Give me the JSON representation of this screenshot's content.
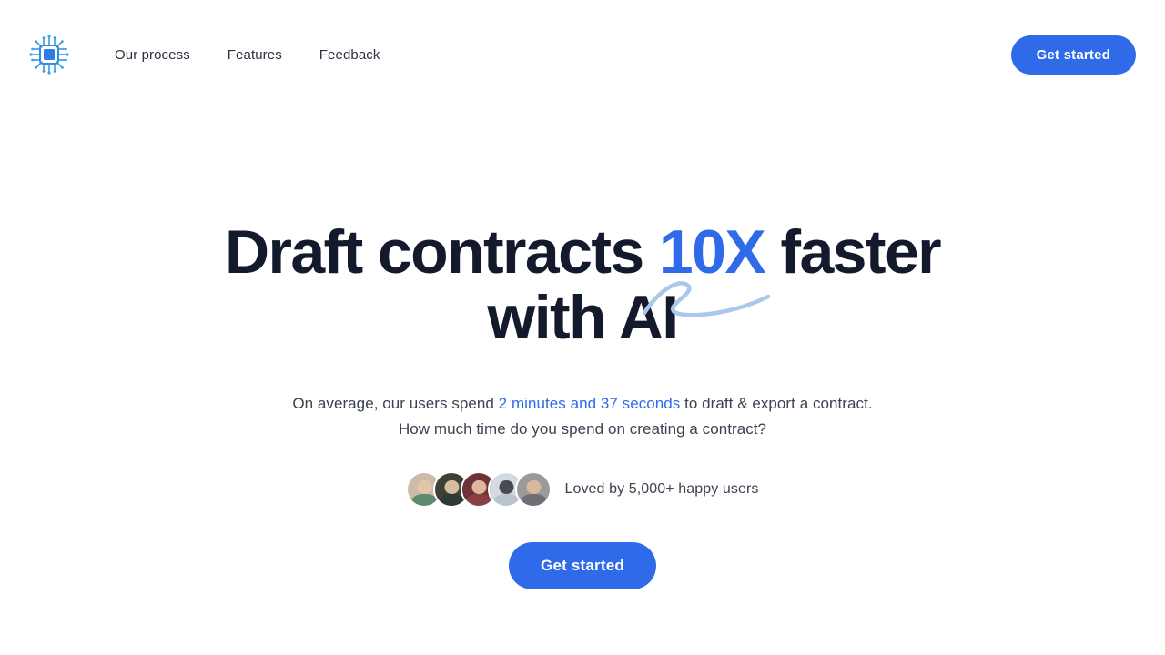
{
  "theme": {
    "accent_blue": "#2f6ae8",
    "headline_navy": "#131a2b",
    "body_text": "#3b4250",
    "swoosh_blue": "#a9c8ea",
    "background": "#ffffff"
  },
  "header": {
    "logo_icon": "cpu-chip-icon",
    "nav": [
      {
        "label": "Our process"
      },
      {
        "label": "Features"
      },
      {
        "label": "Feedback"
      }
    ],
    "cta_label": "Get started"
  },
  "hero": {
    "headline": {
      "part1": "Draft contracts ",
      "accent": "10X",
      "part2": " faster with AI"
    },
    "subtitle": {
      "part1": "On average, our users spend ",
      "accent": "2 minutes and 37 seconds",
      "part2": " to draft & export a contract. How much time do you spend on creating a contract?"
    },
    "social_proof": {
      "text": "Loved by 5,000+ happy users",
      "avatars": [
        {
          "name": "avatar-1",
          "bg": "#cdbba7",
          "head": "#e2c6a8",
          "body": "#5e8a6e"
        },
        {
          "name": "avatar-2",
          "bg": "#3f4036",
          "head": "#d9bda0",
          "body": "#2e3a36"
        },
        {
          "name": "avatar-3",
          "bg": "#6d3339",
          "head": "#e0b79c",
          "body": "#8a3f45"
        },
        {
          "name": "avatar-4",
          "bg": "#d4dae1",
          "head": "#4a4a52",
          "body": "#b9c3cd"
        },
        {
          "name": "avatar-5",
          "bg": "#9a9a9c",
          "head": "#d8b79a",
          "body": "#6d6f73"
        }
      ]
    },
    "cta_label": "Get started"
  }
}
